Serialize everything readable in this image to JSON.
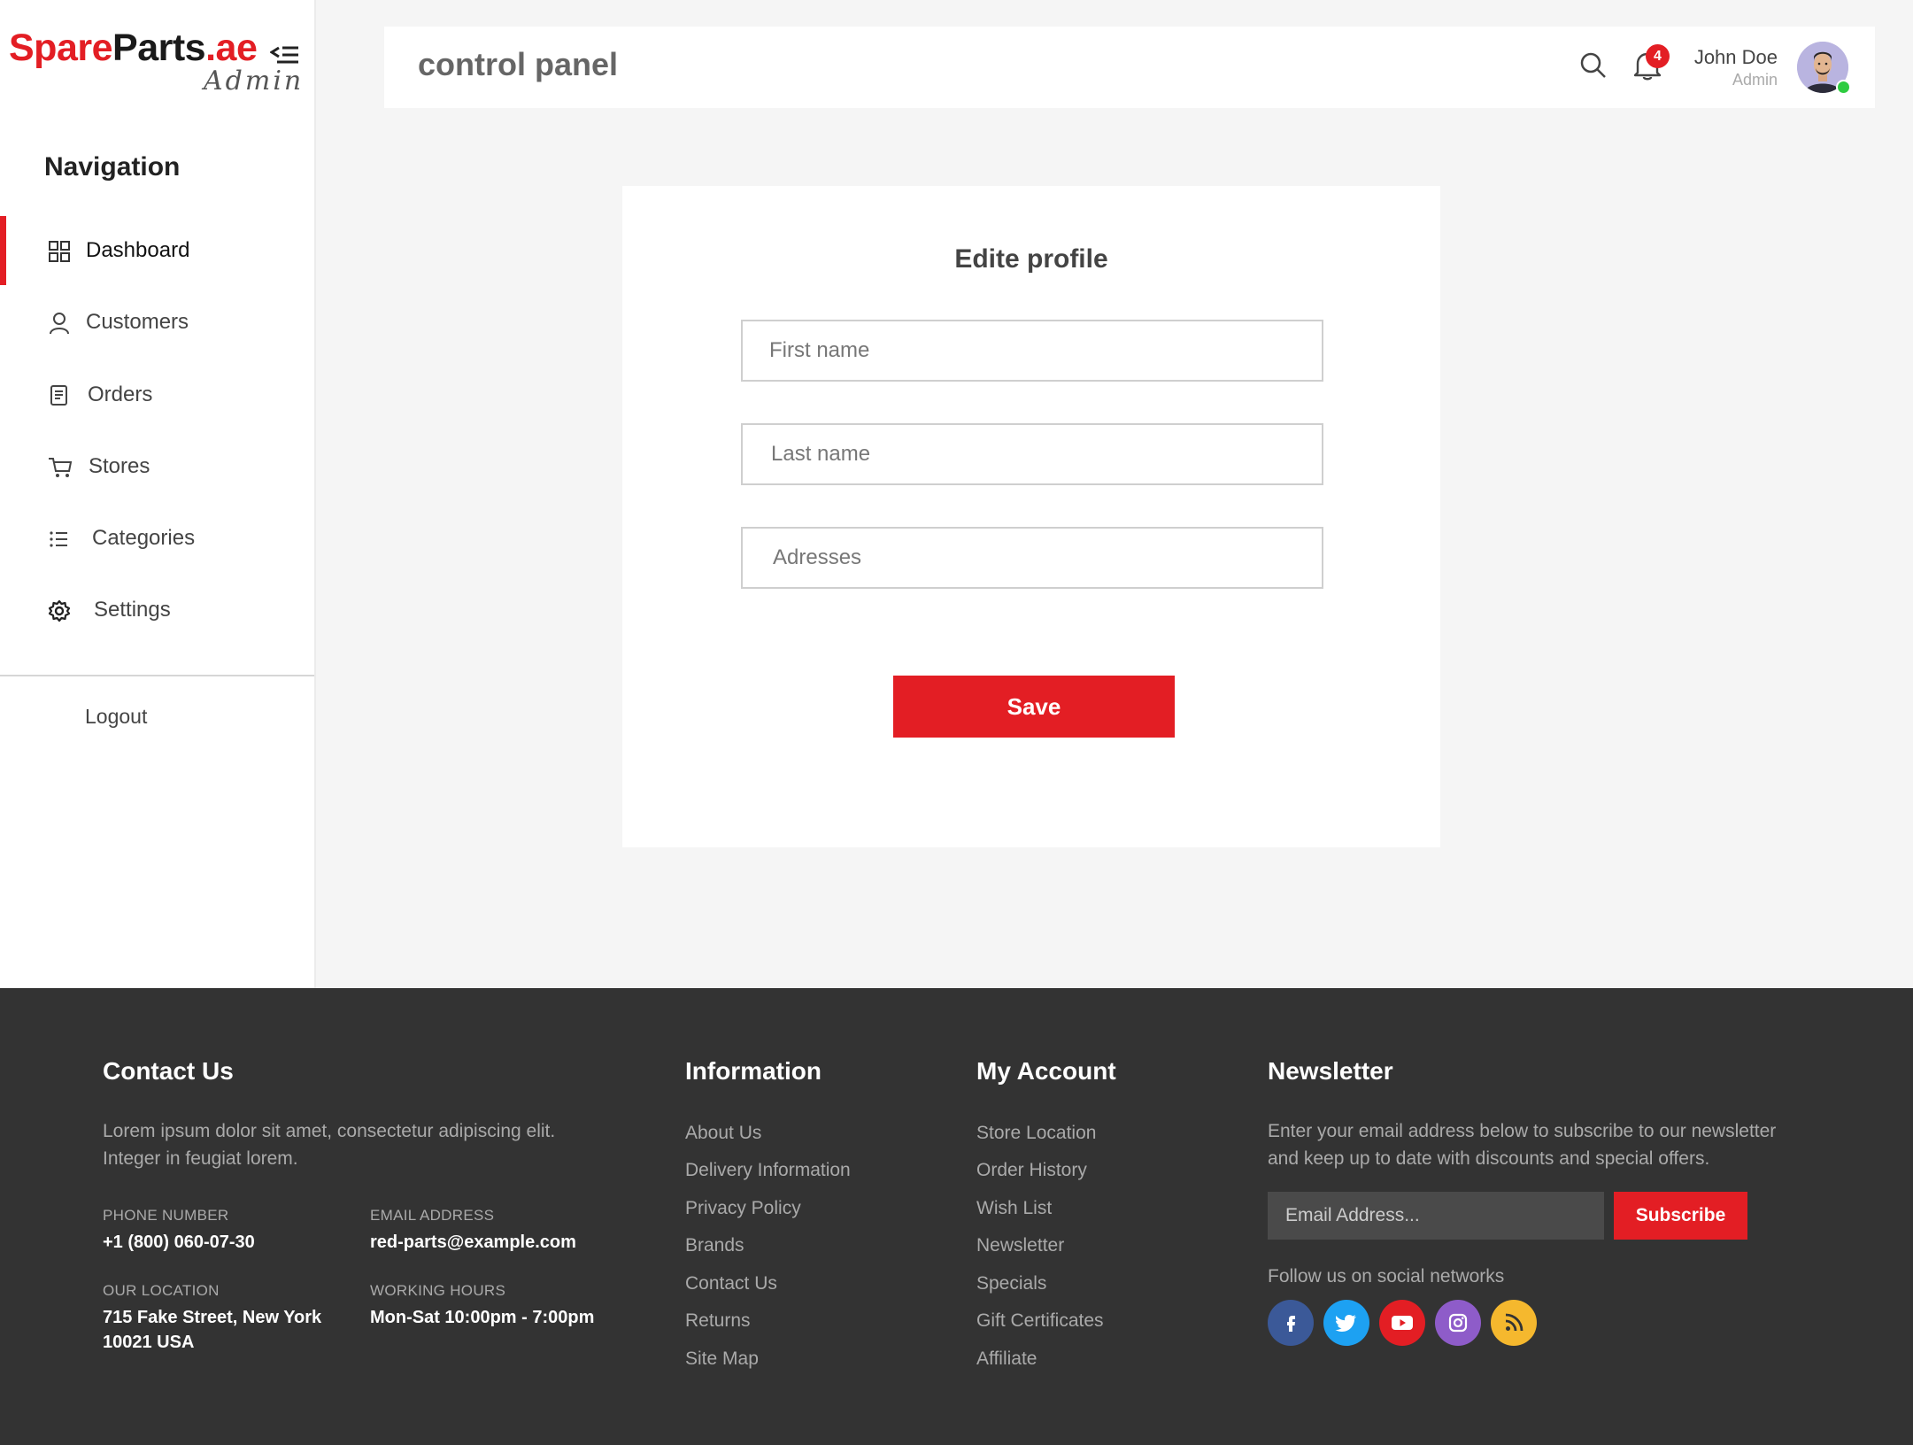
{
  "colors": {
    "accent": "#e31e24",
    "footer_bg": "#333333",
    "facebook": "#3b5998",
    "twitter": "#1da1f2",
    "youtube": "#e31e24",
    "instagram": "#8e5cc9",
    "rss": "#f5b82e"
  },
  "logo": {
    "part1": "Spare",
    "part2": "Parts",
    "part3": ".ae",
    "sub": "Admin"
  },
  "sidebar": {
    "heading": "Navigation",
    "items": [
      {
        "label": "Dashboard",
        "icon": "dashboard-grid-icon",
        "active": true
      },
      {
        "label": "Customers",
        "icon": "user-icon"
      },
      {
        "label": "Orders",
        "icon": "document-icon"
      },
      {
        "label": "Stores",
        "icon": "cart-icon"
      },
      {
        "label": "Categories",
        "icon": "list-icon"
      },
      {
        "label": "Settings",
        "icon": "gear-icon"
      }
    ],
    "logout": "Logout"
  },
  "header": {
    "title": "control panel",
    "notification_count": "4",
    "user_name": "John Doe",
    "user_role": "Admin"
  },
  "form": {
    "title": "Edite  profile",
    "first_name_placeholder": "First name",
    "last_name_placeholder": "Last name",
    "addresses_placeholder": "Adresses",
    "save_label": "Save"
  },
  "footer": {
    "contact": {
      "heading": "Contact Us",
      "text": "Lorem ipsum dolor sit amet, consectetur adipiscing elit. Integer in feugiat lorem.",
      "phone_label": "PHONE NUMBER",
      "phone": "+1 (800) 060-07-30",
      "email_label": "EMAIL ADDRESS",
      "email": "red-parts@example.com",
      "location_label": "OUR LOCATION",
      "location_line1": "715 Fake Street, New York",
      "location_line2": "10021 USA",
      "hours_label": "WORKING HOURS",
      "hours": "Mon-Sat 10:00pm - 7:00pm"
    },
    "information": {
      "heading": "Information",
      "links": [
        "About Us",
        "Delivery Information",
        "Privacy Policy",
        "Brands",
        "Contact Us",
        "Returns",
        "Site Map"
      ]
    },
    "account": {
      "heading": "My Account",
      "links": [
        "Store Location",
        "Order History",
        "Wish List",
        "Newsletter",
        "Specials",
        "Gift Certificates",
        "Affiliate"
      ]
    },
    "newsletter": {
      "heading": "Newsletter",
      "text_line1": "Enter your email address below to subscribe to our newsletter",
      "text_line2": "and keep up to date with discounts and special offers.",
      "email_placeholder": "Email Address...",
      "subscribe_label": "Subscribe",
      "follow_text": "Follow us on social networks"
    }
  }
}
